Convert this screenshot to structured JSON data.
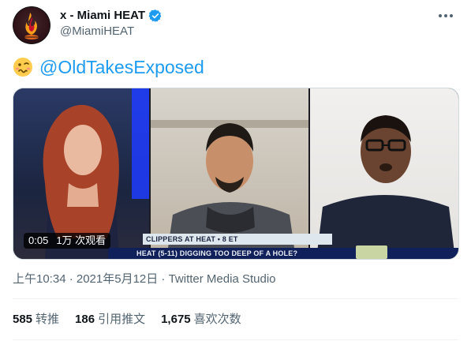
{
  "header": {
    "display_name": "x - Miami HEAT",
    "handle": "@MiamiHEAT"
  },
  "icons": {
    "avatar": "miami-heat-logo",
    "verified": "verified-badge-icon",
    "more": "more-options-icon",
    "emoji": "woozy-face-emoji"
  },
  "tweet": {
    "mention": "@OldTakesExposed"
  },
  "media": {
    "duration": "0:05",
    "views": "1万 次观看",
    "lower_third": "CLIPPERS AT HEAT • 8 ET",
    "ticker": "HEAT (5-11) DIGGING TOO DEEP OF A HOLE?"
  },
  "meta": {
    "time": "上午10:34 · 2021年5月12日 · ",
    "source": "Twitter Media Studio"
  },
  "stats": {
    "retweets_count": "585",
    "retweets_label": "转推",
    "quotes_count": "186",
    "quotes_label": "引用推文",
    "likes_count": "1,675",
    "likes_label": "喜欢次数"
  },
  "colors": {
    "accent": "#1d9bf0",
    "secondary_text": "#536471",
    "primary_text": "#0f1419",
    "divider": "#eff3f4"
  }
}
